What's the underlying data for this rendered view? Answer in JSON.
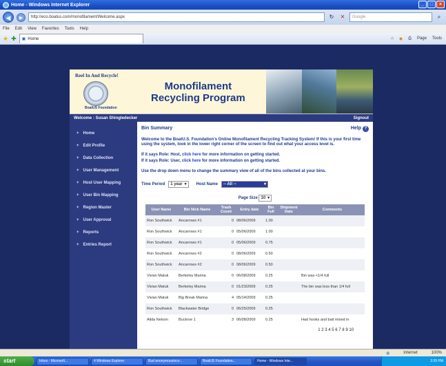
{
  "window": {
    "title": "Home - Windows Internet Explorer"
  },
  "browser": {
    "url": "http://eco.boatus.com/monofilament/Welcome.aspx",
    "search_placeholder": "Google",
    "menus": [
      "File",
      "Edit",
      "View",
      "Favorites",
      "Tools",
      "Help"
    ],
    "tab_title": "Home",
    "tools": [
      "Page",
      "Tools"
    ]
  },
  "banner": {
    "tagline": "Reel In And Recycle!",
    "logo_caption": "BoatUS Foundation",
    "title_line1": "Monofilament",
    "title_line2": "Recycling Program"
  },
  "welcome": {
    "text": "Welcome : Susan Shingledecker",
    "signout": "Signout"
  },
  "sidebar": {
    "items": [
      {
        "label": "Home"
      },
      {
        "label": "Edit Profile"
      },
      {
        "label": "Data Collection"
      },
      {
        "label": "User Management"
      },
      {
        "label": "Host User Mapping"
      },
      {
        "label": "User Bin Mapping"
      },
      {
        "label": "Region Master"
      },
      {
        "label": "User Approval"
      },
      {
        "label": "Reports"
      },
      {
        "label": "Entries Report"
      }
    ]
  },
  "content": {
    "heading": "Bin Summary",
    "help": "Help",
    "intro": "Welcome to the BoatU.S. Foundation's Online Monofilament Recycling Tracking System! If this is your first time using the system, look in the lower right corner of the screen to find out what your access level is.",
    "host_prefix": "If it says Role: Host,",
    "host_link": "click here",
    "host_suffix": "for more information on getting started.",
    "user_prefix": "If it says Role: User,",
    "user_link": "click here",
    "user_suffix": "for more information on getting started.",
    "dropdown_note": "Use the drop down menu to change the summary view of all of the bins collected at your bins.",
    "time_period_label": "Time Period",
    "time_period_value": "1 year",
    "host_name_label": "Host Name",
    "host_name_value": "-- All --",
    "page_size_label": "Page Size",
    "page_size_value": "10"
  },
  "table": {
    "headers": [
      "User Name",
      "Bin Nick Name",
      "Trash Count",
      "Entry date",
      "Bin Full",
      "Shipment Date",
      "Comments"
    ],
    "rows": [
      [
        "Ron Southwick",
        "Ancarrows #1",
        "0",
        "08/06/2009",
        "1.00",
        "",
        ""
      ],
      [
        "Ron Southwick",
        "Ancarrows #1",
        "0",
        "05/06/2009",
        "1.00",
        "",
        ""
      ],
      [
        "Ron Southwick",
        "Ancarrows #1",
        "0",
        "05/06/2009",
        "0.75",
        "",
        ""
      ],
      [
        "Ron Southwick",
        "Ancarrows #2",
        "0",
        "08/06/2009",
        "0.50",
        "",
        ""
      ],
      [
        "Ron Southwick",
        "Ancarrows #2",
        "0",
        "08/06/2009",
        "0.50",
        "",
        ""
      ],
      [
        "Vivian Matuk",
        "Berkeley Marina",
        "0",
        "06/08/2009",
        "0.25",
        "",
        "Bin was <1/4 full"
      ],
      [
        "Vivian Matuk",
        "Berkeley Marina",
        "0",
        "01/23/2009",
        "0.25",
        "",
        "The bin was less than 1/4 full"
      ],
      [
        "Vivian Matuk",
        "Big Break Marina",
        "4",
        "05/14/2009",
        "0.25",
        "",
        ""
      ],
      [
        "Ron Southwick",
        "Blackwater Bridge",
        "0",
        "06/25/2009",
        "0.25",
        "",
        ""
      ],
      [
        "Alida Nelson",
        "Buckroe 1",
        "3",
        "06/08/2009",
        "0.25",
        "",
        "Had hooks and bait mixed in"
      ]
    ],
    "pager": "1 2 3 4 5 6 7 8 9 10"
  },
  "status": {
    "zone": "Internet",
    "zoom": "100%"
  },
  "taskbar": {
    "start": "start",
    "items": [
      "Inbox - Microsoft...",
      "4 Windows Explorer",
      "Bud anonymous/eco...",
      "BoatUS Foundation...",
      "Home - Windows Inte..."
    ],
    "tray": "3:35 PM"
  }
}
